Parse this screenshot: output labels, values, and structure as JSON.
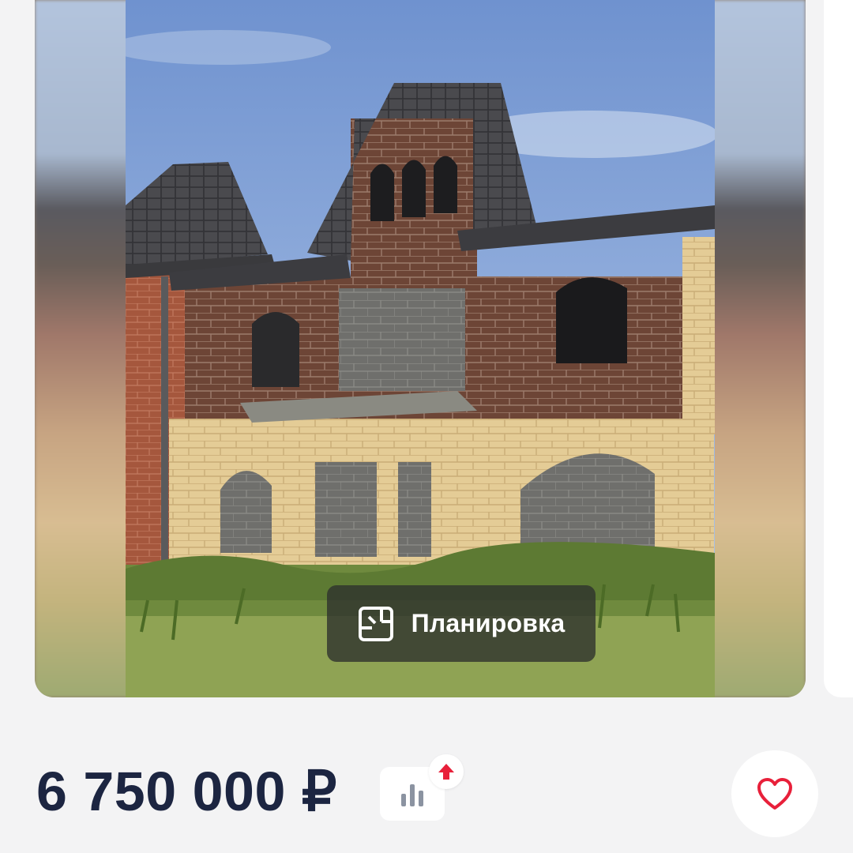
{
  "gallery": {
    "photo_alt": "Планировка",
    "floor_plan_button": {
      "label": "Планировка",
      "icon": "floor-plan-icon"
    }
  },
  "listing": {
    "price": "6 750 000 ₽",
    "stats_icon": "bar-chart-icon",
    "trend_icon": "arrow-up-icon",
    "favorite_icon": "heart-outline-icon"
  },
  "colors": {
    "price_text": "#1c2541",
    "favorite_heart": "#e8203a",
    "trend_arrow": "#e8203a",
    "stats_icon": "#8b93a1"
  }
}
